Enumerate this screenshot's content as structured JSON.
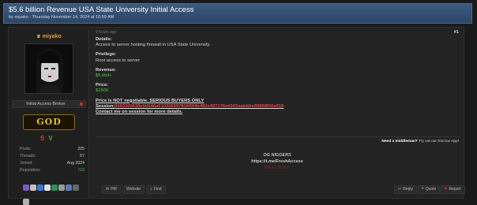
{
  "thread": {
    "title": "$5.6 billion Revenue USA State University Initial Access",
    "byline": "by miyako - Thursday November 14, 2024 at 10:50 AM"
  },
  "author": {
    "username": "miyako",
    "role": "Initial Access Broker",
    "rank_badge": "GOD",
    "rank_letters": [
      "S",
      "V"
    ],
    "stats": [
      {
        "label": "Posts:",
        "value": "205"
      },
      {
        "label": "Threads:",
        "value": "67"
      },
      {
        "label": "Joined:",
        "value": "Aug 2024"
      },
      {
        "label": "Reputation:",
        "value": "718"
      }
    ],
    "award_colors": [
      "#7a5cc2",
      "#c0c0c0",
      "#3b7bd6",
      "#e0e0e0",
      "#2a8f5a",
      "#9a9a9a",
      "#5a7ab5",
      "#666666",
      "#b0b0b0"
    ]
  },
  "post": {
    "time": "9 hours ago",
    "number": "#1",
    "details_label": "Details:",
    "details_text": "Access to server hosting firewall in USA State University.",
    "privilege_label": "Privilege:",
    "privilege_text": "Root access to server",
    "revenue_label": "Revenue:",
    "revenue_text": "$5.6bil+",
    "price_label": "Price:",
    "price_text": "$1500",
    "warning": "Price is NOT negotiable. SERIOUS BUYERS ONLY",
    "session_label": "Session:",
    "session_id": "0583326638e9d646a610306997816f9f4b482e427176ed105aabbbe99868f56e918",
    "contact": "Contact me on session for more details."
  },
  "middleman": {
    "text": "Need a middleman?",
    "link": "Try out our Escrow App!"
  },
  "signature": {
    "line1": "OG NIGGERS",
    "line2": "https://t.me/FreshAccess",
    "line3": "HELLCAT"
  },
  "buttons": {
    "pm": "PM",
    "website": "Website",
    "find": "Find",
    "reply": "Reply",
    "quote": "Quote",
    "report": "Report"
  }
}
